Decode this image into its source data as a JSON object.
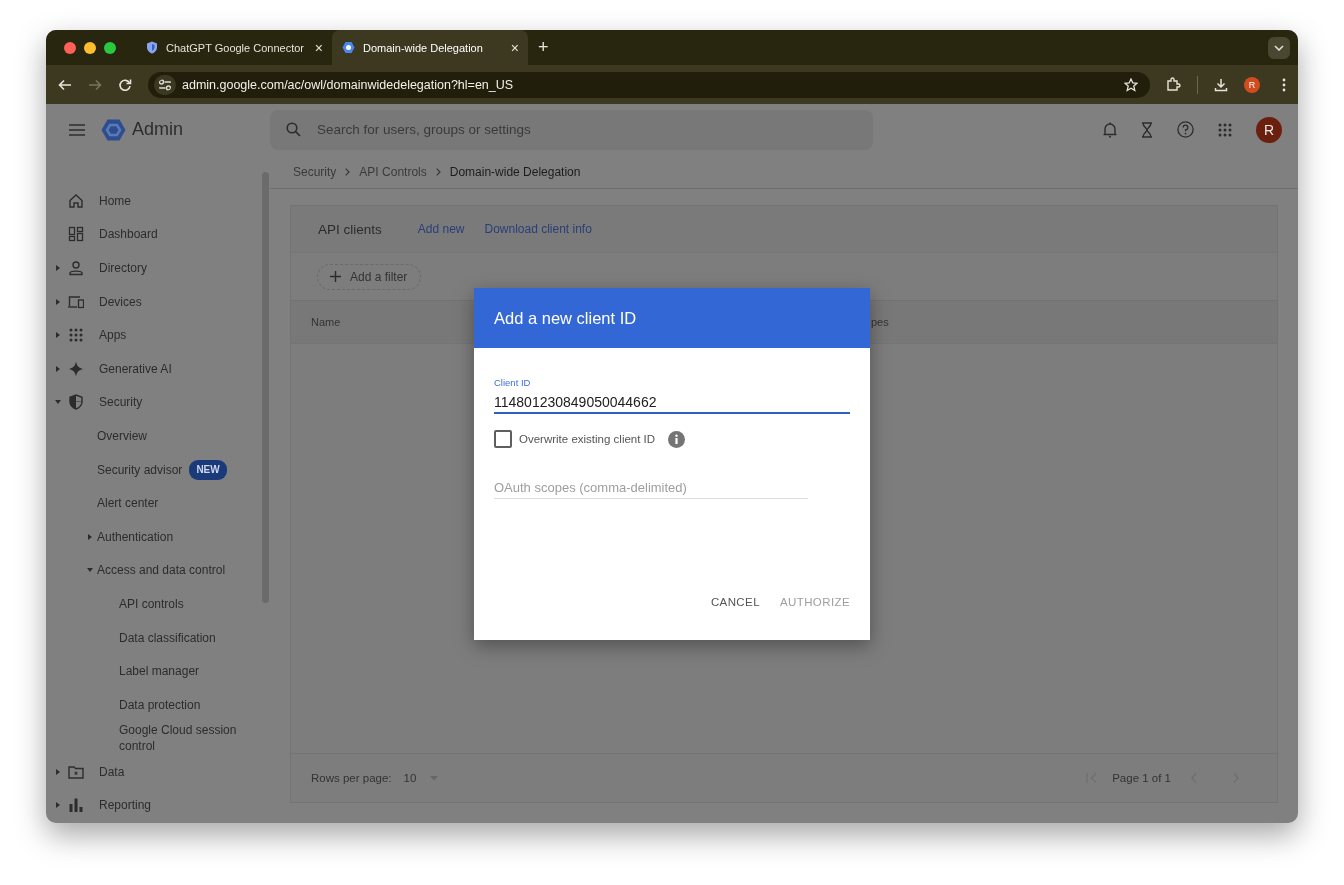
{
  "browser": {
    "tabs": [
      {
        "title": "ChatGPT Google Connector",
        "selected": false,
        "close": "×"
      },
      {
        "title": "Domain-wide Delegation",
        "selected": true,
        "close": "×"
      }
    ],
    "new_tab": "+",
    "nav_buttons": [
      {
        "kind": "back",
        "disabled": false
      },
      {
        "kind": "forward",
        "disabled": true
      },
      {
        "kind": "reload",
        "disabled": false
      }
    ],
    "address": "admin.google.com/ac/owl/domainwidedelegation?hl=en_US",
    "profile": "R"
  },
  "header": {
    "product": "Admin",
    "search": {
      "placeholder": "Search for users, groups or settings"
    },
    "avatar": "R"
  },
  "sidebar": {
    "items": [
      {
        "label": "Home"
      },
      {
        "label": "Dashboard"
      },
      {
        "label": "Directory",
        "expanded": false
      },
      {
        "label": "Devices",
        "expanded": false
      },
      {
        "label": "Apps",
        "expanded": false
      },
      {
        "label": "Generative AI",
        "expanded": false
      },
      {
        "label": "Security",
        "expanded": true,
        "children": [
          {
            "label": "Overview"
          },
          {
            "label": "Security advisor",
            "badge": "NEW"
          },
          {
            "label": "Alert center"
          },
          {
            "label": "Authentication",
            "expanded": false
          },
          {
            "label": "Access and data control",
            "expanded": true,
            "children": [
              {
                "label": "API controls"
              },
              {
                "label": "Data classification"
              },
              {
                "label": "Label manager"
              },
              {
                "label": "Data protection"
              },
              {
                "label": "Google Cloud session control"
              }
            ]
          }
        ]
      },
      {
        "label": "Data",
        "expanded": false
      },
      {
        "label": "Reporting",
        "expanded": false
      }
    ]
  },
  "breadcrumb": [
    {
      "label": "Security",
      "current": false
    },
    {
      "label": "API Controls",
      "current": false
    },
    {
      "label": "Domain-wide Delegation",
      "current": true
    }
  ],
  "card": {
    "title": "API clients",
    "actions": [
      "Add new",
      "Download client info"
    ],
    "filter": "Add a filter",
    "columns": [
      "Name",
      "pes"
    ],
    "footer": {
      "rows_label": "Rows per page:",
      "rows_value": "10",
      "page": "Page 1 of 1"
    }
  },
  "dialog": {
    "title": "Add a new client ID",
    "client_id": {
      "label": "Client ID",
      "value": "114801230849050044662"
    },
    "overwrite": {
      "label": "Overwrite existing client ID",
      "checked": false
    },
    "scopes": {
      "placeholder": "OAuth scopes (comma-delimited)"
    },
    "buttons": [
      {
        "label": "CANCEL",
        "disabled": false
      },
      {
        "label": "AUTHORIZE",
        "disabled": true
      }
    ]
  }
}
